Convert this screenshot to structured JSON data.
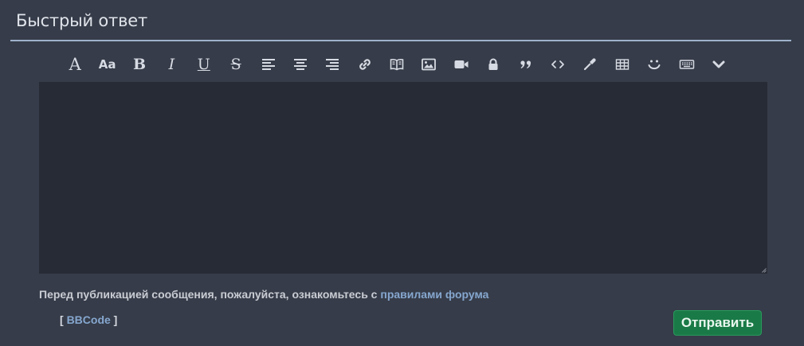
{
  "header": {
    "title": "Быстрый ответ"
  },
  "toolbar": {
    "icons": [
      {
        "name": "font-family-icon",
        "label": "A"
      },
      {
        "name": "font-size-icon",
        "label": "Aa"
      },
      {
        "name": "bold-icon",
        "label": "B"
      },
      {
        "name": "italic-icon",
        "label": "I"
      },
      {
        "name": "underline-icon",
        "label": "U"
      },
      {
        "name": "strikethrough-icon",
        "label": "S"
      },
      {
        "name": "align-left-icon"
      },
      {
        "name": "align-center-icon"
      },
      {
        "name": "align-right-icon"
      },
      {
        "name": "link-icon"
      },
      {
        "name": "book-icon"
      },
      {
        "name": "image-icon"
      },
      {
        "name": "video-icon"
      },
      {
        "name": "lock-icon"
      },
      {
        "name": "quote-icon"
      },
      {
        "name": "code-icon"
      },
      {
        "name": "color-picker-icon"
      },
      {
        "name": "table-icon"
      },
      {
        "name": "smiley-icon"
      },
      {
        "name": "keyboard-icon"
      },
      {
        "name": "chevron-down-icon"
      }
    ]
  },
  "editor": {
    "value": "",
    "placeholder": ""
  },
  "notice": {
    "text": "Перед публикацией сообщения, пожалуйста, ознакомьтесь с ",
    "link": "правилами форума"
  },
  "bbcode": {
    "open": "[ ",
    "link": "BBCode",
    "close": " ]"
  },
  "actions": {
    "submit_label": "Отправить"
  },
  "colors": {
    "background": "#363c49",
    "editor_background": "#272b35",
    "accent_link": "#86a7cf",
    "submit_button": "#1a7a47",
    "title_rule": "#9fb2cc"
  }
}
